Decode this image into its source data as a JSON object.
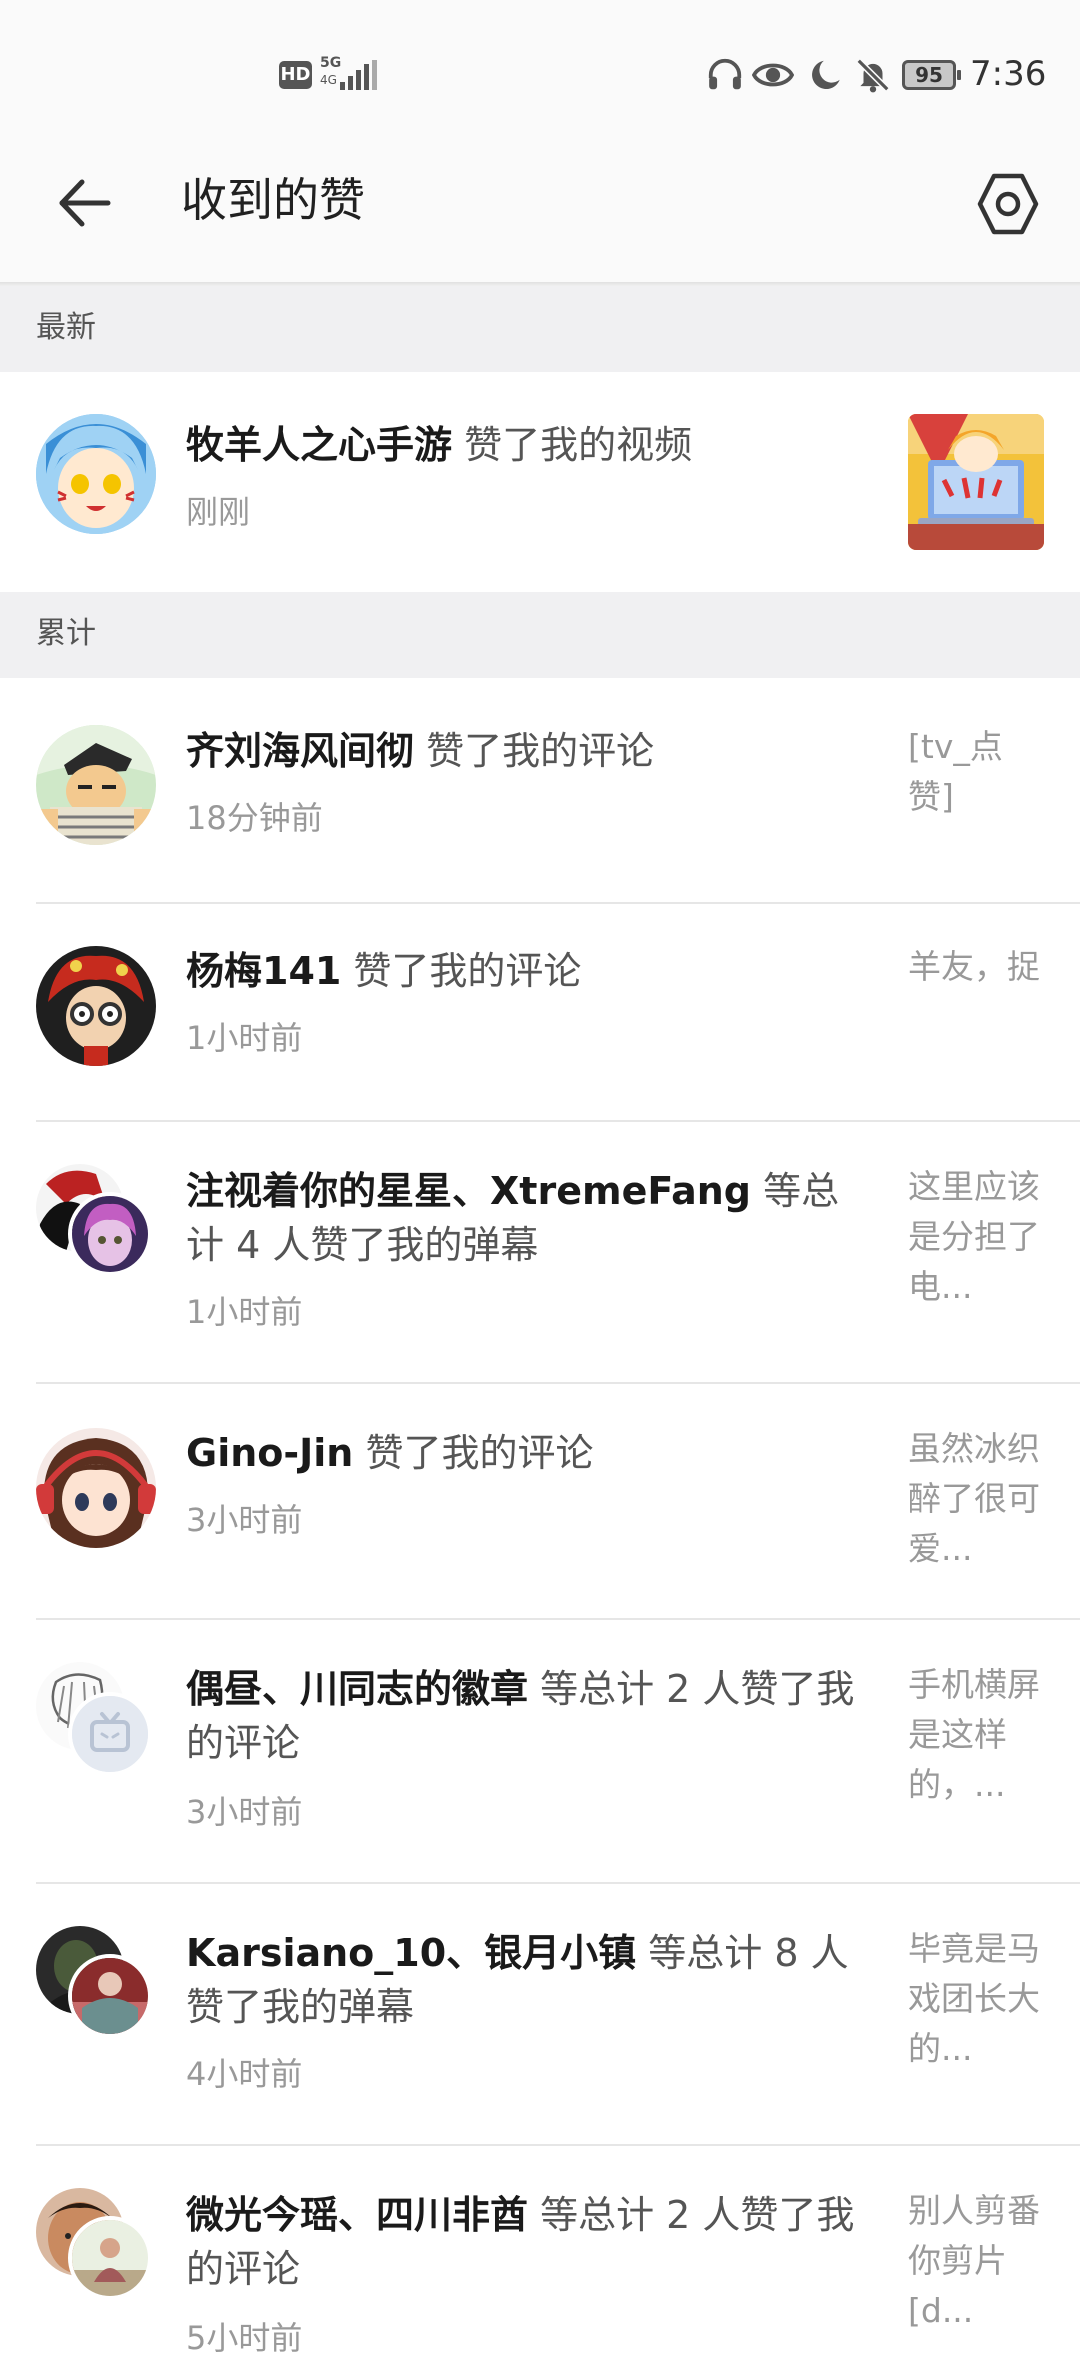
{
  "status_bar": {
    "hd_label": "HD",
    "network_label": "5G",
    "network_sub": "4G",
    "battery": "95",
    "time": "7:36"
  },
  "header": {
    "title": "收到的赞"
  },
  "sections": {
    "latest_label": "最新",
    "total_label": "累计"
  },
  "latest_item": {
    "names": "牧羊人之心手游",
    "action": " 赞了我的视频",
    "time": "刚刚"
  },
  "items": [
    {
      "names": "齐刘海风间彻",
      "action": " 赞了我的评论",
      "time": "18分钟前",
      "preview": "[tv_点赞]"
    },
    {
      "names": "杨梅141",
      "action": " 赞了我的评论",
      "time": "1小时前",
      "preview": "羊友，捉"
    },
    {
      "names": "注视着你的星星、XtremeFang",
      "action": " 等总计 4 人赞了我的弹幕",
      "time": "1小时前",
      "preview": "这里应该是分担了电..."
    },
    {
      "names": "Gino-Jin",
      "action": " 赞了我的评论",
      "time": "3小时前",
      "preview": "虽然冰织醉了很可爱..."
    },
    {
      "names": "偶昼、川同志的徽章",
      "action": " 等总计 2 人赞了我的评论",
      "time": "3小时前",
      "preview": "手机横屏是这样的，..."
    },
    {
      "names": "Karsiano_10、银月小镇",
      "action": " 等总计 8 人赞了我的弹幕",
      "time": "4小时前",
      "preview": "毕竟是马戏团长大的..."
    },
    {
      "names": "微光今瑶、四川非酋",
      "action": " 等总计 2 人赞了我的评论",
      "time": "5小时前",
      "preview": "别人剪番你剪片[d..."
    }
  ]
}
